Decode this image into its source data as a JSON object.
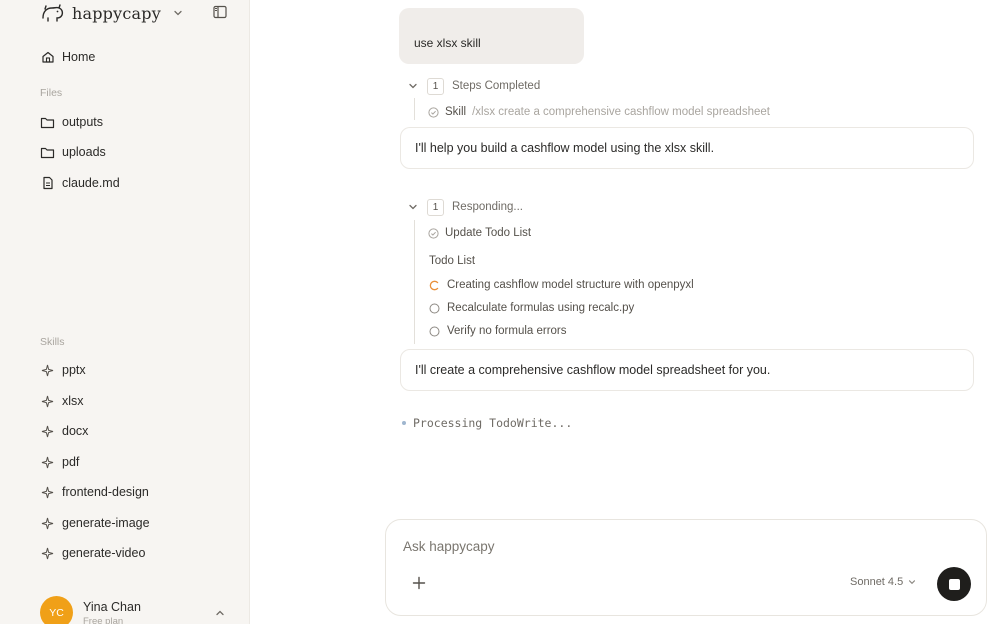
{
  "sidebar": {
    "brand": "happycapy",
    "home_label": "Home",
    "files_section": "Files",
    "files": [
      {
        "label": "outputs",
        "icon": "folder-icon"
      },
      {
        "label": "uploads",
        "icon": "folder-icon"
      },
      {
        "label": "claude.md",
        "icon": "file-icon"
      }
    ],
    "skills_section": "Skills",
    "skills": [
      "pptx",
      "xlsx",
      "docx",
      "pdf",
      "frontend-design",
      "generate-image",
      "generate-video"
    ],
    "user": {
      "initials": "YC",
      "name": "Yina Chan",
      "plan": "Free plan"
    }
  },
  "chat": {
    "user_message": "use xlsx skill",
    "step1": {
      "count": "1",
      "label": "Steps Completed",
      "skill_label": "Skill",
      "skill_detail": "/xlsx create a comprehensive cashflow model spreadsheet"
    },
    "assistant_msg1": "I'll help you build a cashflow model using the xlsx skill.",
    "step2": {
      "count": "1",
      "label": "Responding...",
      "tool_label": "Update Todo List"
    },
    "todo_title": "Todo List",
    "todos": [
      {
        "text": "Creating cashflow model structure with openpyxl",
        "status": "in-progress"
      },
      {
        "text": "Recalculate formulas using recalc.py",
        "status": "pending"
      },
      {
        "text": "Verify no formula errors",
        "status": "pending"
      }
    ],
    "assistant_msg2": "I'll create a comprehensive cashflow model spreadsheet for you.",
    "processing": "Processing TodoWrite..."
  },
  "composer": {
    "placeholder": "Ask happycapy",
    "model": "Sonnet 4.5"
  },
  "colors": {
    "avatar": "#f0a018",
    "in_progress": "#e9903a",
    "stop_button": "#1f1e1c"
  }
}
